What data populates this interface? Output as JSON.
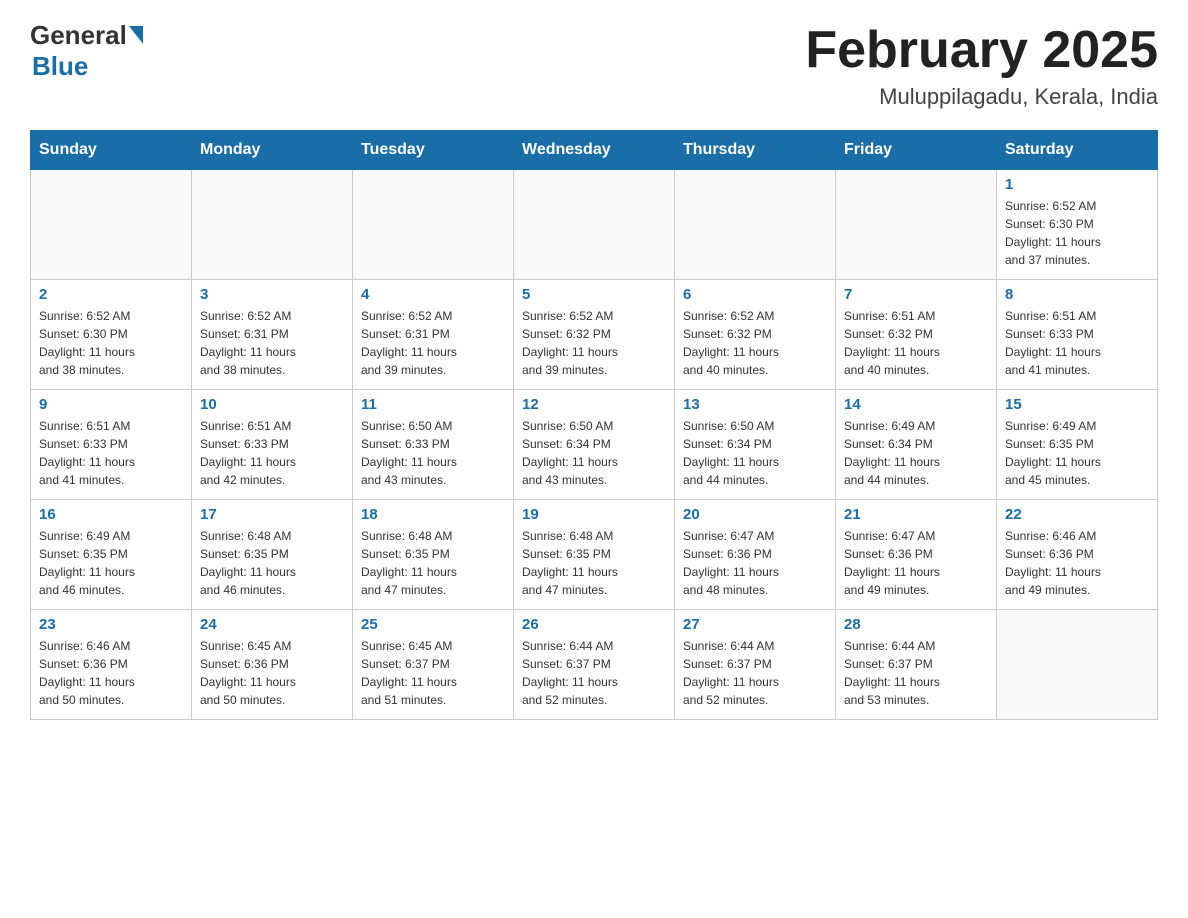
{
  "header": {
    "logo_general": "General",
    "logo_blue": "Blue",
    "title": "February 2025",
    "subtitle": "Muluppilagadu, Kerala, India"
  },
  "days_of_week": [
    "Sunday",
    "Monday",
    "Tuesday",
    "Wednesday",
    "Thursday",
    "Friday",
    "Saturday"
  ],
  "weeks": [
    [
      {
        "day": "",
        "info": ""
      },
      {
        "day": "",
        "info": ""
      },
      {
        "day": "",
        "info": ""
      },
      {
        "day": "",
        "info": ""
      },
      {
        "day": "",
        "info": ""
      },
      {
        "day": "",
        "info": ""
      },
      {
        "day": "1",
        "info": "Sunrise: 6:52 AM\nSunset: 6:30 PM\nDaylight: 11 hours\nand 37 minutes."
      }
    ],
    [
      {
        "day": "2",
        "info": "Sunrise: 6:52 AM\nSunset: 6:30 PM\nDaylight: 11 hours\nand 38 minutes."
      },
      {
        "day": "3",
        "info": "Sunrise: 6:52 AM\nSunset: 6:31 PM\nDaylight: 11 hours\nand 38 minutes."
      },
      {
        "day": "4",
        "info": "Sunrise: 6:52 AM\nSunset: 6:31 PM\nDaylight: 11 hours\nand 39 minutes."
      },
      {
        "day": "5",
        "info": "Sunrise: 6:52 AM\nSunset: 6:32 PM\nDaylight: 11 hours\nand 39 minutes."
      },
      {
        "day": "6",
        "info": "Sunrise: 6:52 AM\nSunset: 6:32 PM\nDaylight: 11 hours\nand 40 minutes."
      },
      {
        "day": "7",
        "info": "Sunrise: 6:51 AM\nSunset: 6:32 PM\nDaylight: 11 hours\nand 40 minutes."
      },
      {
        "day": "8",
        "info": "Sunrise: 6:51 AM\nSunset: 6:33 PM\nDaylight: 11 hours\nand 41 minutes."
      }
    ],
    [
      {
        "day": "9",
        "info": "Sunrise: 6:51 AM\nSunset: 6:33 PM\nDaylight: 11 hours\nand 41 minutes."
      },
      {
        "day": "10",
        "info": "Sunrise: 6:51 AM\nSunset: 6:33 PM\nDaylight: 11 hours\nand 42 minutes."
      },
      {
        "day": "11",
        "info": "Sunrise: 6:50 AM\nSunset: 6:33 PM\nDaylight: 11 hours\nand 43 minutes."
      },
      {
        "day": "12",
        "info": "Sunrise: 6:50 AM\nSunset: 6:34 PM\nDaylight: 11 hours\nand 43 minutes."
      },
      {
        "day": "13",
        "info": "Sunrise: 6:50 AM\nSunset: 6:34 PM\nDaylight: 11 hours\nand 44 minutes."
      },
      {
        "day": "14",
        "info": "Sunrise: 6:49 AM\nSunset: 6:34 PM\nDaylight: 11 hours\nand 44 minutes."
      },
      {
        "day": "15",
        "info": "Sunrise: 6:49 AM\nSunset: 6:35 PM\nDaylight: 11 hours\nand 45 minutes."
      }
    ],
    [
      {
        "day": "16",
        "info": "Sunrise: 6:49 AM\nSunset: 6:35 PM\nDaylight: 11 hours\nand 46 minutes."
      },
      {
        "day": "17",
        "info": "Sunrise: 6:48 AM\nSunset: 6:35 PM\nDaylight: 11 hours\nand 46 minutes."
      },
      {
        "day": "18",
        "info": "Sunrise: 6:48 AM\nSunset: 6:35 PM\nDaylight: 11 hours\nand 47 minutes."
      },
      {
        "day": "19",
        "info": "Sunrise: 6:48 AM\nSunset: 6:35 PM\nDaylight: 11 hours\nand 47 minutes."
      },
      {
        "day": "20",
        "info": "Sunrise: 6:47 AM\nSunset: 6:36 PM\nDaylight: 11 hours\nand 48 minutes."
      },
      {
        "day": "21",
        "info": "Sunrise: 6:47 AM\nSunset: 6:36 PM\nDaylight: 11 hours\nand 49 minutes."
      },
      {
        "day": "22",
        "info": "Sunrise: 6:46 AM\nSunset: 6:36 PM\nDaylight: 11 hours\nand 49 minutes."
      }
    ],
    [
      {
        "day": "23",
        "info": "Sunrise: 6:46 AM\nSunset: 6:36 PM\nDaylight: 11 hours\nand 50 minutes."
      },
      {
        "day": "24",
        "info": "Sunrise: 6:45 AM\nSunset: 6:36 PM\nDaylight: 11 hours\nand 50 minutes."
      },
      {
        "day": "25",
        "info": "Sunrise: 6:45 AM\nSunset: 6:37 PM\nDaylight: 11 hours\nand 51 minutes."
      },
      {
        "day": "26",
        "info": "Sunrise: 6:44 AM\nSunset: 6:37 PM\nDaylight: 11 hours\nand 52 minutes."
      },
      {
        "day": "27",
        "info": "Sunrise: 6:44 AM\nSunset: 6:37 PM\nDaylight: 11 hours\nand 52 minutes."
      },
      {
        "day": "28",
        "info": "Sunrise: 6:44 AM\nSunset: 6:37 PM\nDaylight: 11 hours\nand 53 minutes."
      },
      {
        "day": "",
        "info": ""
      }
    ]
  ]
}
